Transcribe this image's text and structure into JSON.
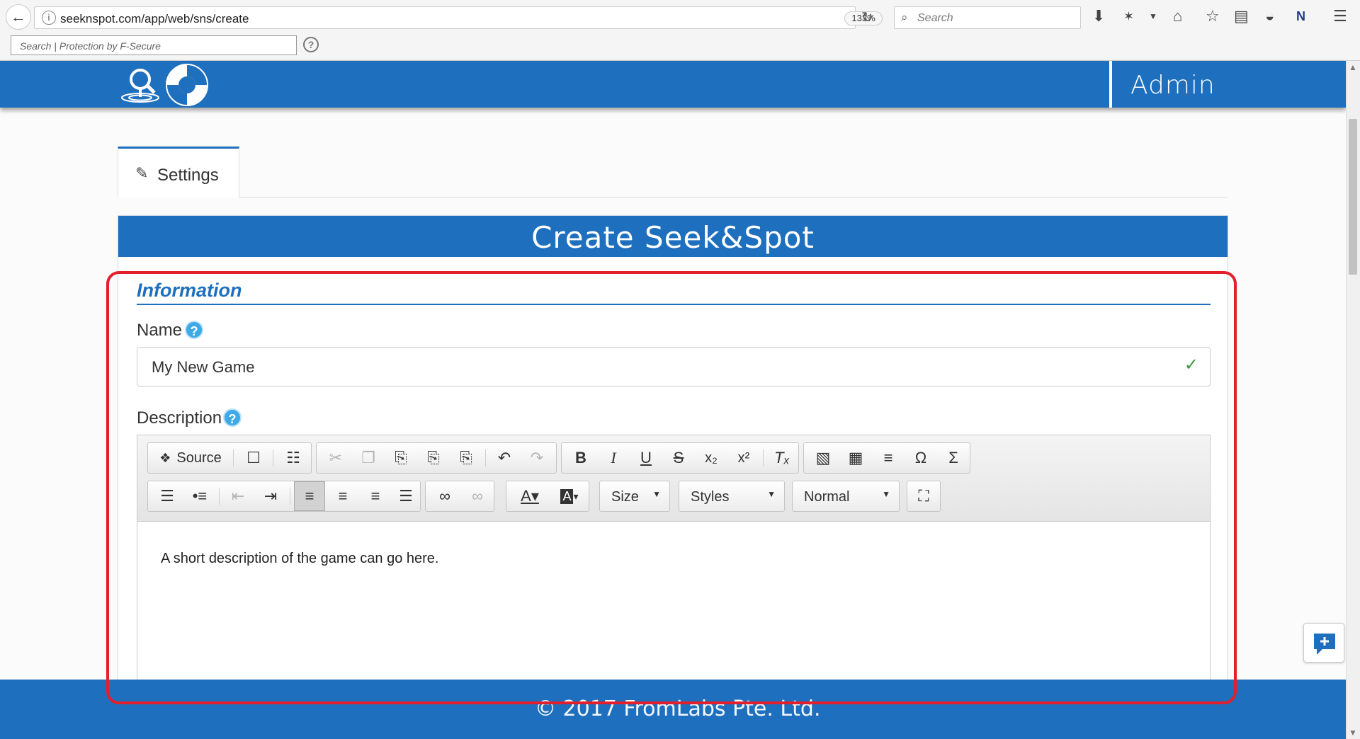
{
  "browser": {
    "url": "seeknspot.com/app/web/sns/create",
    "zoom": "133%",
    "search_placeholder": "Search",
    "security_placeholder": "Search | Protection by F-Secure",
    "security_help": "?"
  },
  "header": {
    "admin_label": "Admin"
  },
  "tabs": [
    {
      "label": "Settings",
      "icon": "edit-icon"
    }
  ],
  "panel": {
    "title": "Create Seek&Spot",
    "section_title": "Information",
    "name_label": "Name",
    "name_value": "My New Game",
    "description_label": "Description",
    "help_glyph": "?"
  },
  "editor": {
    "source_label": "Source",
    "size_label": "Size",
    "styles_label": "Styles",
    "format_label": "Normal",
    "content": "A short description of the game can go here."
  },
  "footer": {
    "text": "© 2017 FromLabs Pte. Ltd."
  },
  "colors": {
    "brand_blue": "#1e6fbd",
    "highlight_red": "#e3202a",
    "help_blue": "#3ea9e7",
    "valid_green": "#3c9a3c"
  }
}
